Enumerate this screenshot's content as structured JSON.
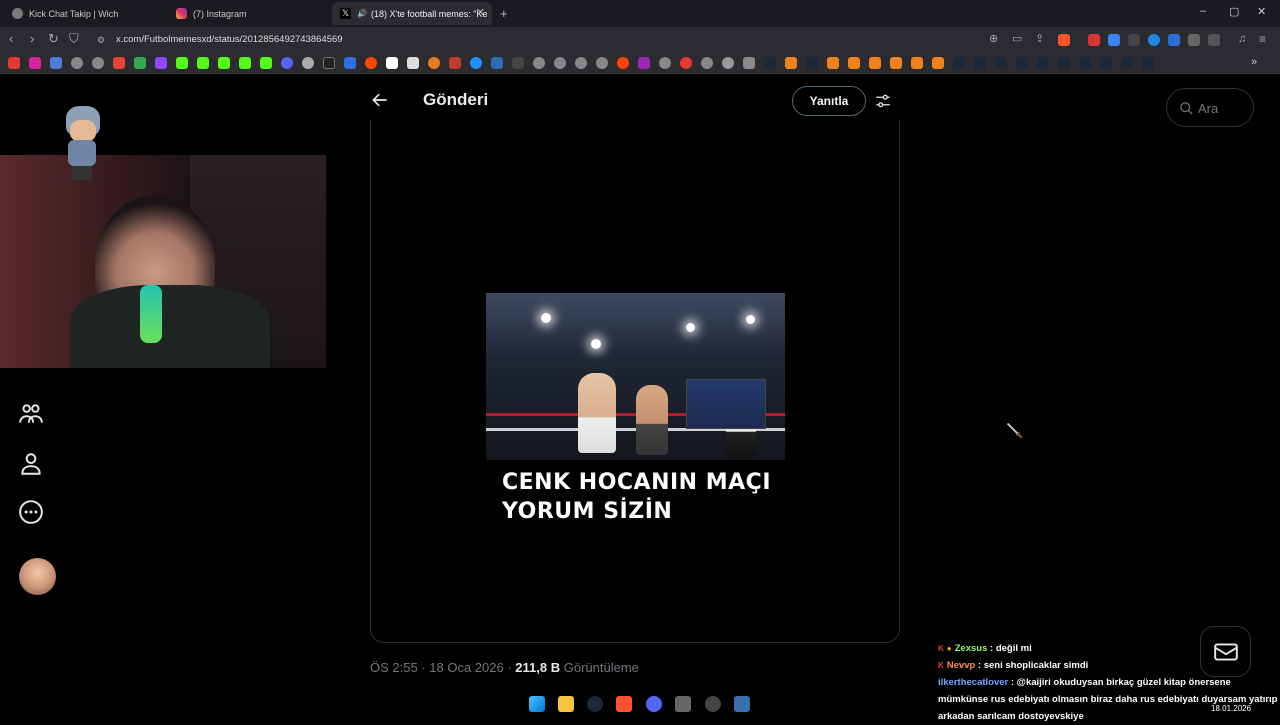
{
  "browser": {
    "tabs": [
      {
        "title": "Kick Chat Takip | Wich",
        "active": false
      },
      {
        "title": "(7) Instagram",
        "active": false
      },
      {
        "title": "(18) X'te football memes: \"Ke",
        "active": true
      }
    ],
    "new_tab": "+",
    "window_controls": {
      "minimize": "–",
      "maximize": "▢",
      "close": "✕"
    },
    "url": "x.com/Futbolmemesxd/status/2012856492743864569"
  },
  "header": {
    "title": "Gönderi",
    "reply_label": "Yanıtla"
  },
  "search": {
    "placeholder": "Ara"
  },
  "post": {
    "caption_line1": "CENK HOCANIN MAÇI",
    "caption_line2": "YORUM SİZİN",
    "time": "ÖS 2:55",
    "separator": " · ",
    "date": "18 Oca 2026",
    "views": "211,8 B",
    "views_label": "Görüntüleme"
  },
  "chat": {
    "messages": [
      {
        "user": "Zexsus",
        "text": " : değil mi"
      },
      {
        "user": "Nevvp",
        "text": " : seni shoplicaklar simdi"
      },
      {
        "user": "ilkerthecatlover",
        "text": " : @kaijiri okuduysan birkaç güzel kitap önersene mümkünse rus edebiyatı olmasın biraz daha rus edebiyatı duyarsam yatırıp arkadan sarılcam dostoyevskiye"
      }
    ]
  },
  "taskbar": {
    "date": "18.01.2026"
  },
  "colors": {
    "accent": "#1d9bf0",
    "background": "#000000",
    "border": "#2f3336",
    "muted_text": "#71767b"
  }
}
